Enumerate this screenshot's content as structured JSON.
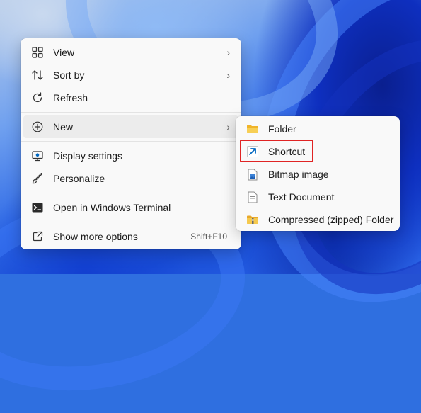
{
  "context_menu": {
    "items": [
      {
        "label": "View",
        "icon": "view-icon",
        "has_submenu": true
      },
      {
        "label": "Sort by",
        "icon": "sort-icon",
        "has_submenu": true
      },
      {
        "label": "Refresh",
        "icon": "refresh-icon",
        "has_submenu": false
      },
      {
        "label": "New",
        "icon": "new-plus-icon",
        "has_submenu": true
      },
      {
        "label": "Display settings",
        "icon": "display-icon",
        "has_submenu": false
      },
      {
        "label": "Personalize",
        "icon": "brush-icon",
        "has_submenu": false
      },
      {
        "label": "Open in Windows Terminal",
        "icon": "terminal-icon",
        "has_submenu": false
      },
      {
        "label": "Show more options",
        "icon": "more-options-icon",
        "shortcut": "Shift+F10"
      }
    ]
  },
  "submenu_new": {
    "items": [
      {
        "label": "Folder",
        "icon": "folder-icon"
      },
      {
        "label": "Shortcut",
        "icon": "shortcut-icon",
        "highlighted": true
      },
      {
        "label": "Bitmap image",
        "icon": "bitmap-icon"
      },
      {
        "label": "Text Document",
        "icon": "text-document-icon"
      },
      {
        "label": "Compressed (zipped) Folder",
        "icon": "zip-folder-icon"
      }
    ]
  },
  "colors": {
    "accent": "#0067c0",
    "highlight_border": "#e02424",
    "folder": "#f5c542"
  }
}
